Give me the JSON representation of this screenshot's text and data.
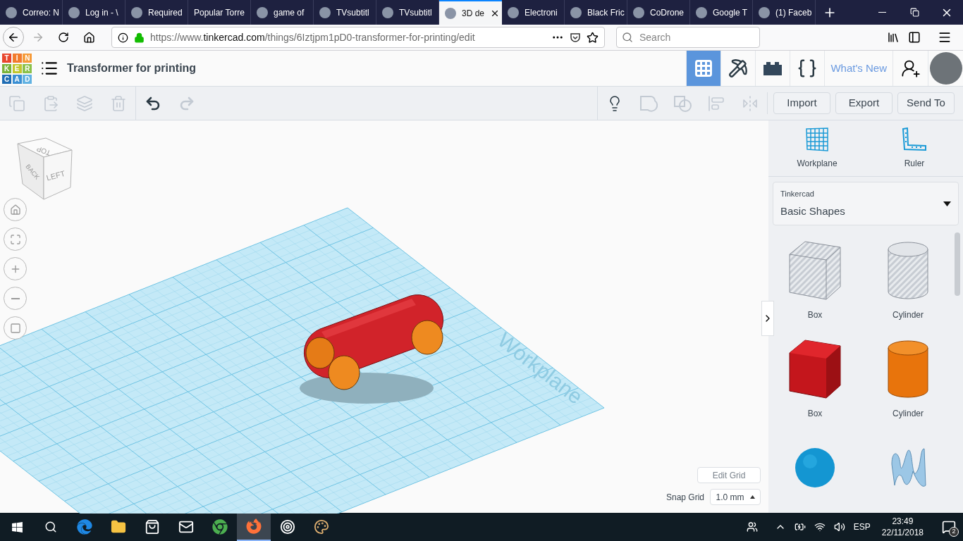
{
  "browser": {
    "tabs": [
      {
        "label": "Correo: N",
        "selected": false,
        "has_icon": true
      },
      {
        "label": "Log in - \\",
        "selected": false,
        "has_icon": true
      },
      {
        "label": "Required",
        "selected": false,
        "has_icon": true
      },
      {
        "label": "Popular Torre",
        "selected": false,
        "has_icon": false
      },
      {
        "label": "game of",
        "selected": false,
        "has_icon": true
      },
      {
        "label": "TVsubtitl",
        "selected": false,
        "has_icon": true
      },
      {
        "label": "TVsubtitl",
        "selected": false,
        "has_icon": true
      },
      {
        "label": "3D de",
        "selected": true,
        "has_icon": true
      },
      {
        "label": "Electroni",
        "selected": false,
        "has_icon": true
      },
      {
        "label": "Black Fric",
        "selected": false,
        "has_icon": true
      },
      {
        "label": "CoDrone",
        "selected": false,
        "has_icon": true
      },
      {
        "label": "Google T",
        "selected": false,
        "has_icon": true
      },
      {
        "label": "(1) Faceb",
        "selected": false,
        "has_icon": true
      }
    ],
    "url": {
      "prefix": "https://www.",
      "domain": "tinkercad.com",
      "path": "/things/6Iztjpm1pD0-transformer-for-printing/edit"
    },
    "search": {
      "placeholder": "Search"
    }
  },
  "app": {
    "logo": [
      {
        "letter": "T",
        "color": "#e8472e"
      },
      {
        "letter": "I",
        "color": "#f27b2e"
      },
      {
        "letter": "N",
        "color": "#f69a38"
      },
      {
        "letter": "K",
        "color": "#7ab33a"
      },
      {
        "letter": "E",
        "color": "#c1c72e"
      },
      {
        "letter": "R",
        "color": "#8bc14a"
      },
      {
        "letter": "C",
        "color": "#1f6db4"
      },
      {
        "letter": "A",
        "color": "#3a8fd3"
      },
      {
        "letter": "D",
        "color": "#62b2e2"
      }
    ],
    "title": "Transformer for printing",
    "modes": [
      {
        "kind": "grid",
        "selected": true
      },
      {
        "kind": "pickaxe",
        "selected": false
      },
      {
        "kind": "brick",
        "selected": false
      },
      {
        "kind": "code",
        "selected": false
      }
    ],
    "whats_new": "What's New"
  },
  "toolbar": {
    "tools": [
      {
        "kind": "copy",
        "disabled": true
      },
      {
        "kind": "paste",
        "disabled": true
      },
      {
        "kind": "duplicate",
        "disabled": true
      },
      {
        "kind": "delete",
        "disabled": true
      },
      {
        "kind": "undo",
        "disabled": false
      },
      {
        "kind": "redo",
        "disabled": true
      }
    ],
    "tools_right": [
      {
        "kind": "notes",
        "disabled": false
      },
      {
        "kind": "group",
        "disabled": true
      },
      {
        "kind": "ungroup",
        "disabled": true
      },
      {
        "kind": "align",
        "disabled": true
      },
      {
        "kind": "mirror",
        "disabled": true
      }
    ],
    "buttons": [
      "Import",
      "Export",
      "Send To"
    ]
  },
  "view_cube": {
    "top": "TOP",
    "back": "BACK",
    "left": "LEFT"
  },
  "workplane_label": "Workplane",
  "grid_controls": {
    "edit": "Edit Grid",
    "snap_label": "Snap Grid",
    "snap_value": "1.0 mm"
  },
  "panel": {
    "tools": [
      {
        "kind": "workplane",
        "label": "Workplane"
      },
      {
        "kind": "ruler",
        "label": "Ruler"
      }
    ],
    "library": {
      "source": "Tinkercad",
      "name": "Basic Shapes"
    },
    "shapes": [
      {
        "kind": "box-hole",
        "label": "Box"
      },
      {
        "kind": "cylinder-hole",
        "label": "Cylinder"
      },
      {
        "kind": "box",
        "label": "Box"
      },
      {
        "kind": "cylinder",
        "label": "Cylinder"
      },
      {
        "kind": "sphere"
      },
      {
        "kind": "scribble"
      }
    ]
  },
  "taskbar": {
    "apps": [
      {
        "kind": "edge",
        "selected": false
      },
      {
        "kind": "folder",
        "selected": false
      },
      {
        "kind": "store",
        "selected": false
      },
      {
        "kind": "mail",
        "selected": false
      },
      {
        "kind": "chrome",
        "selected": false
      },
      {
        "kind": "firefox",
        "selected": true
      },
      {
        "kind": "target",
        "selected": false
      },
      {
        "kind": "paint",
        "selected": false
      }
    ],
    "language": "ESP",
    "time": "23:49",
    "date": "22/11/2018",
    "notifications": "2"
  }
}
